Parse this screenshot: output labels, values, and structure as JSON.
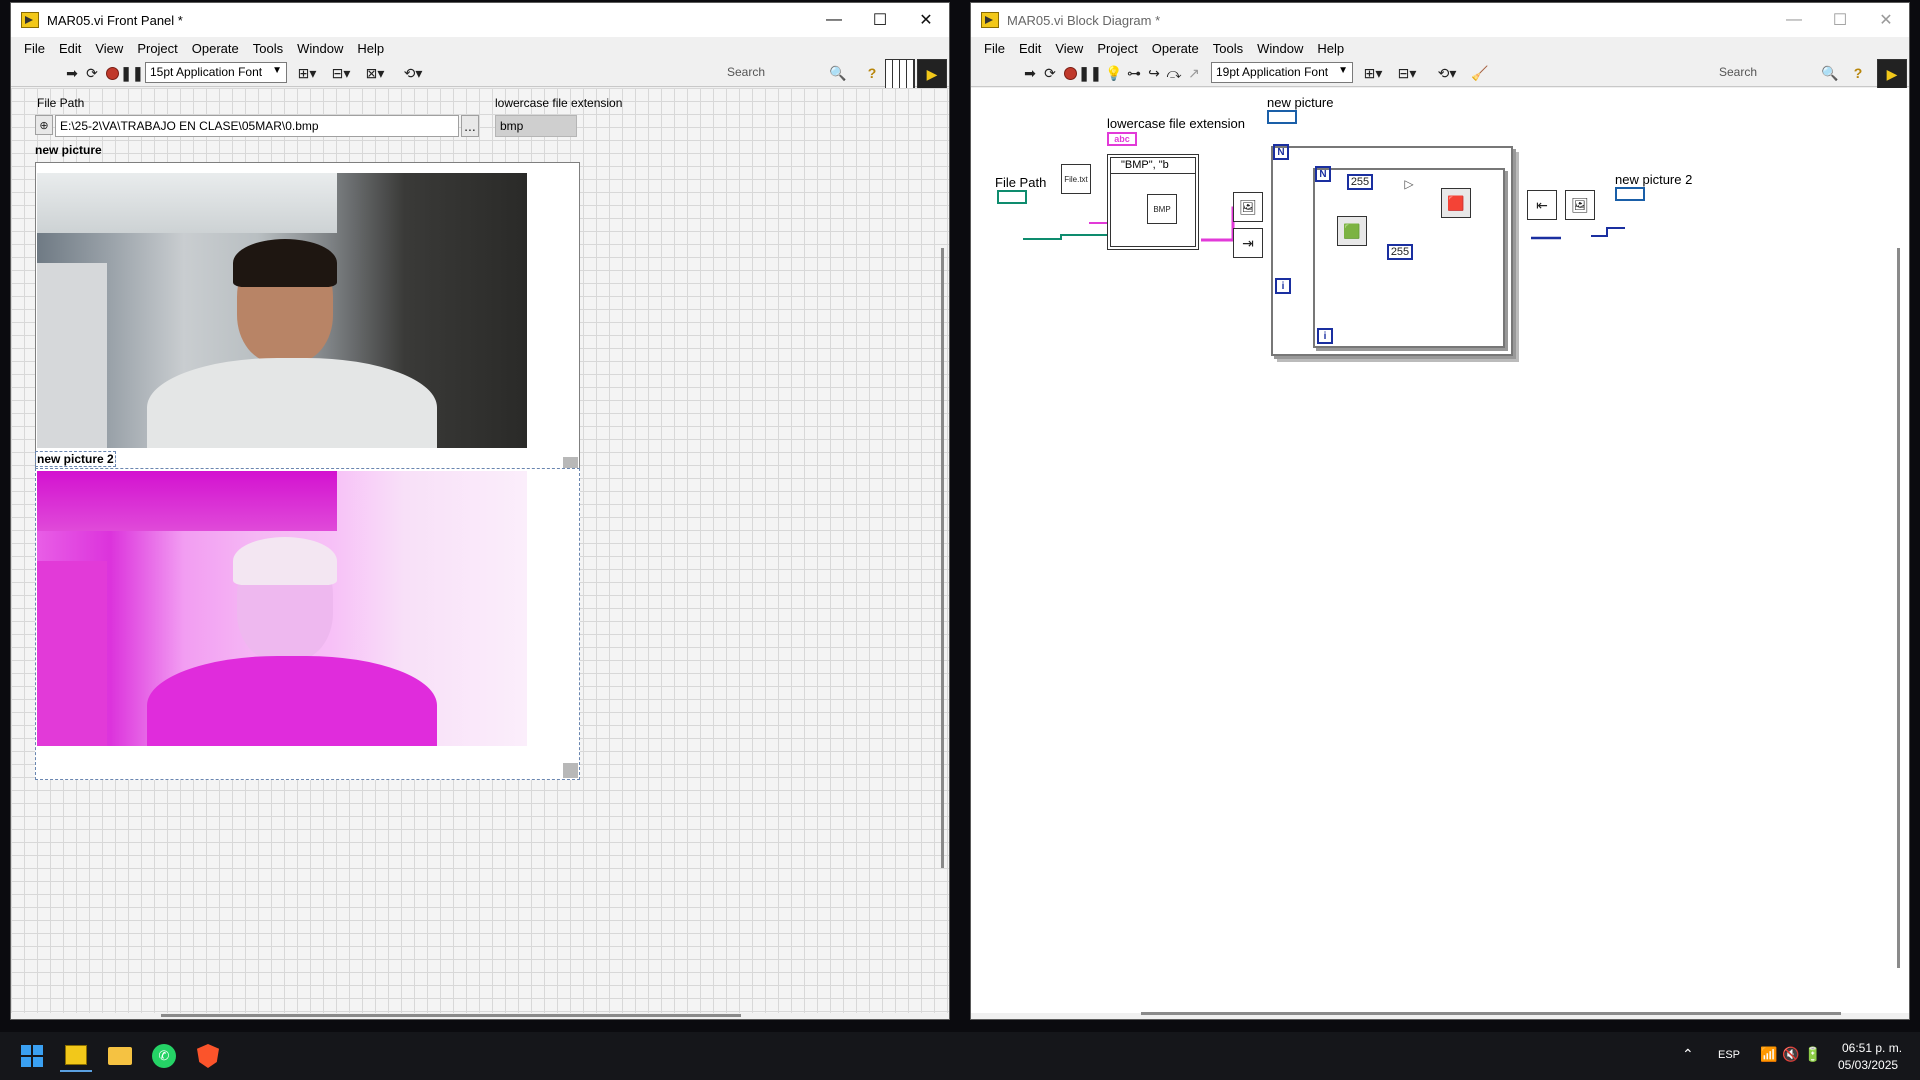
{
  "front_panel": {
    "title": "MAR05.vi Front Panel *",
    "menu": [
      "File",
      "Edit",
      "View",
      "Project",
      "Operate",
      "Tools",
      "Window",
      "Help"
    ],
    "toolbar": {
      "font": "15pt Application Font",
      "search_placeholder": "Search"
    },
    "controls": {
      "file_path_label": "File Path",
      "file_path_value": "E:\\25-2\\VA\\TRABAJO EN CLASE\\05MAR\\0.bmp",
      "browse_label": "...",
      "ext_label": "lowercase file extension",
      "ext_value": "bmp",
      "picture1_label": "new picture",
      "picture2_label": "new picture 2"
    }
  },
  "block_diagram": {
    "title": "MAR05.vi Block Diagram *",
    "menu": [
      "File",
      "Edit",
      "View",
      "Project",
      "Operate",
      "Tools",
      "Window",
      "Help"
    ],
    "toolbar": {
      "font": "19pt Application Font",
      "search_placeholder": "Search"
    },
    "labels": {
      "file_path": "File Path",
      "ext": "lowercase file extension",
      "new_picture": "new picture",
      "new_picture_2": "new picture 2",
      "case_selector": "\"BMP\", \"b",
      "const1": "255",
      "const2": "255",
      "loop_n_outer": "N",
      "loop_n_inner": "N",
      "loop_i_outer": "i",
      "loop_i_inner": "i",
      "file_icon_text": "File.txt",
      "bmp_icon_text": "BMP",
      "abc_terminal": "abc"
    }
  },
  "taskbar": {
    "language": "ESP",
    "time": "06:51 p. m.",
    "date": "05/03/2025"
  },
  "colors": {
    "path_wire": "#0e8c6e",
    "string_wire": "#e23ad8",
    "numeric_wire": "#1a2fa0",
    "accent": "#f2c81a"
  }
}
